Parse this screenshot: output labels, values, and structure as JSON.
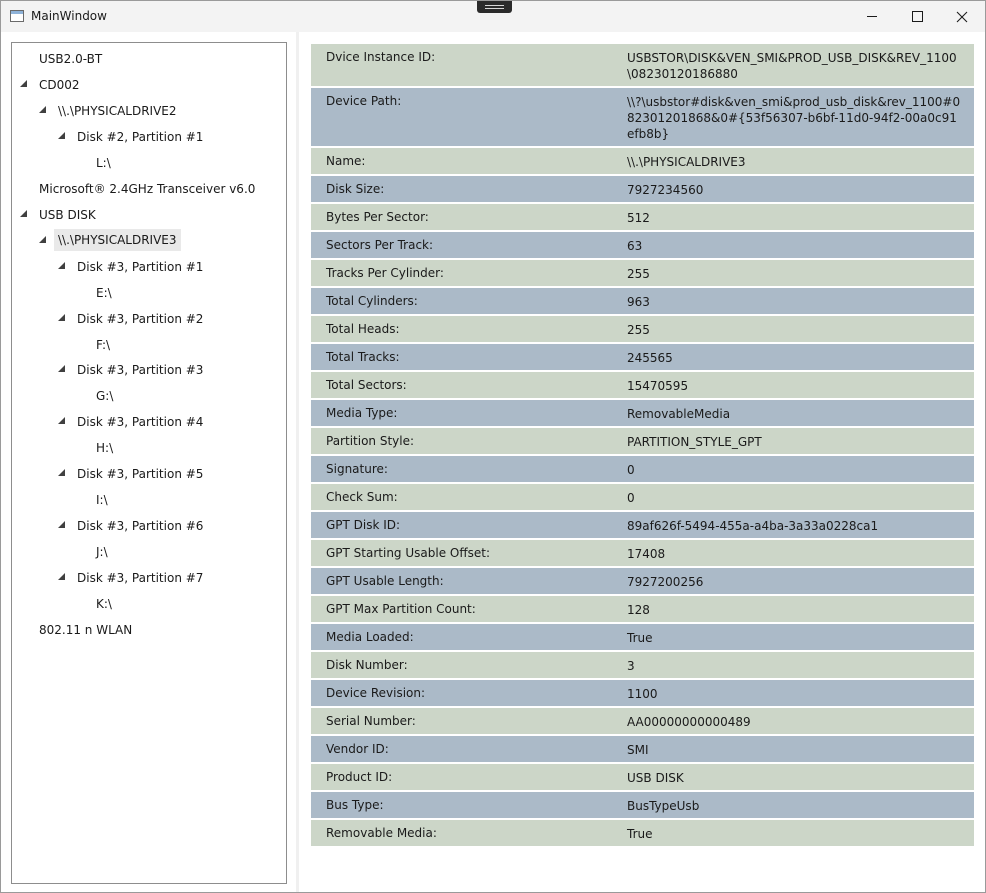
{
  "window": {
    "title": "MainWindow",
    "controls": {
      "minimize": "minimize-icon",
      "maximize": "maximize-icon",
      "close": "close-icon"
    }
  },
  "tree": {
    "nodes": [
      {
        "label": "USB2.0-BT",
        "expanded": null
      },
      {
        "label": "CD002",
        "expanded": true
      },
      {
        "label": "\\\\.\\PHYSICALDRIVE2",
        "expanded": true
      },
      {
        "label": "Disk #2, Partition #1",
        "expanded": true
      },
      {
        "label": "L:\\",
        "expanded": null
      },
      {
        "label": "Microsoft® 2.4GHz Transceiver v6.0",
        "expanded": null
      },
      {
        "label": "USB DISK",
        "expanded": true
      },
      {
        "label": "\\\\.\\PHYSICALDRIVE3",
        "expanded": true,
        "selected": true
      },
      {
        "label": "Disk #3, Partition #1",
        "expanded": true
      },
      {
        "label": "E:\\",
        "expanded": null
      },
      {
        "label": "Disk #3, Partition #2",
        "expanded": true
      },
      {
        "label": "F:\\",
        "expanded": null
      },
      {
        "label": "Disk #3, Partition #3",
        "expanded": true
      },
      {
        "label": "G:\\",
        "expanded": null
      },
      {
        "label": "Disk #3, Partition #4",
        "expanded": true
      },
      {
        "label": "H:\\",
        "expanded": null
      },
      {
        "label": "Disk #3, Partition #5",
        "expanded": true
      },
      {
        "label": "I:\\",
        "expanded": null
      },
      {
        "label": "Disk #3, Partition #6",
        "expanded": true
      },
      {
        "label": "J:\\",
        "expanded": null
      },
      {
        "label": "Disk #3, Partition #7",
        "expanded": true
      },
      {
        "label": "K:\\",
        "expanded": null
      },
      {
        "label": "802.11 n WLAN",
        "expanded": null
      }
    ]
  },
  "details": {
    "rows": [
      {
        "key": "Dvice Instance ID:",
        "value": "USBSTOR\\DISK&VEN_SMI&PROD_USB_DISK&REV_1100\\08230120186880"
      },
      {
        "key": "Device Path:",
        "value": "\\\\?\\usbstor#disk&ven_smi&prod_usb_disk&rev_1100#082301201868&0#{53f56307-b6bf-11d0-94f2-00a0c91efb8b}"
      },
      {
        "key": "Name:",
        "value": "\\\\.\\PHYSICALDRIVE3"
      },
      {
        "key": "Disk Size:",
        "value": "7927234560"
      },
      {
        "key": "Bytes Per Sector:",
        "value": "512"
      },
      {
        "key": "Sectors Per Track:",
        "value": "63"
      },
      {
        "key": "Tracks Per Cylinder:",
        "value": "255"
      },
      {
        "key": "Total Cylinders:",
        "value": "963"
      },
      {
        "key": "Total Heads:",
        "value": "255"
      },
      {
        "key": "Total Tracks:",
        "value": "245565"
      },
      {
        "key": "Total Sectors:",
        "value": "15470595"
      },
      {
        "key": "Media Type:",
        "value": "RemovableMedia"
      },
      {
        "key": "Partition Style:",
        "value": "PARTITION_STYLE_GPT"
      },
      {
        "key": "Signature:",
        "value": "0"
      },
      {
        "key": "Check Sum:",
        "value": "0"
      },
      {
        "key": "GPT Disk ID:",
        "value": "89af626f-5494-455a-a4ba-3a33a0228ca1"
      },
      {
        "key": "GPT Starting Usable Offset:",
        "value": "17408"
      },
      {
        "key": "GPT Usable Length:",
        "value": "7927200256"
      },
      {
        "key": "GPT Max Partition Count:",
        "value": "128"
      },
      {
        "key": "Media Loaded:",
        "value": "True"
      },
      {
        "key": "Disk Number:",
        "value": "3"
      },
      {
        "key": "Device Revision:",
        "value": "1100"
      },
      {
        "key": "Serial Number:",
        "value": "AA00000000000489"
      },
      {
        "key": "Vendor ID:",
        "value": "SMI"
      },
      {
        "key": "Product ID:",
        "value": "USB DISK"
      },
      {
        "key": "Bus Type:",
        "value": "BusTypeUsb"
      },
      {
        "key": "Removable Media:",
        "value": "True"
      }
    ]
  },
  "colors": {
    "row_even": "#ccd6c8",
    "row_odd": "#abbac8"
  }
}
